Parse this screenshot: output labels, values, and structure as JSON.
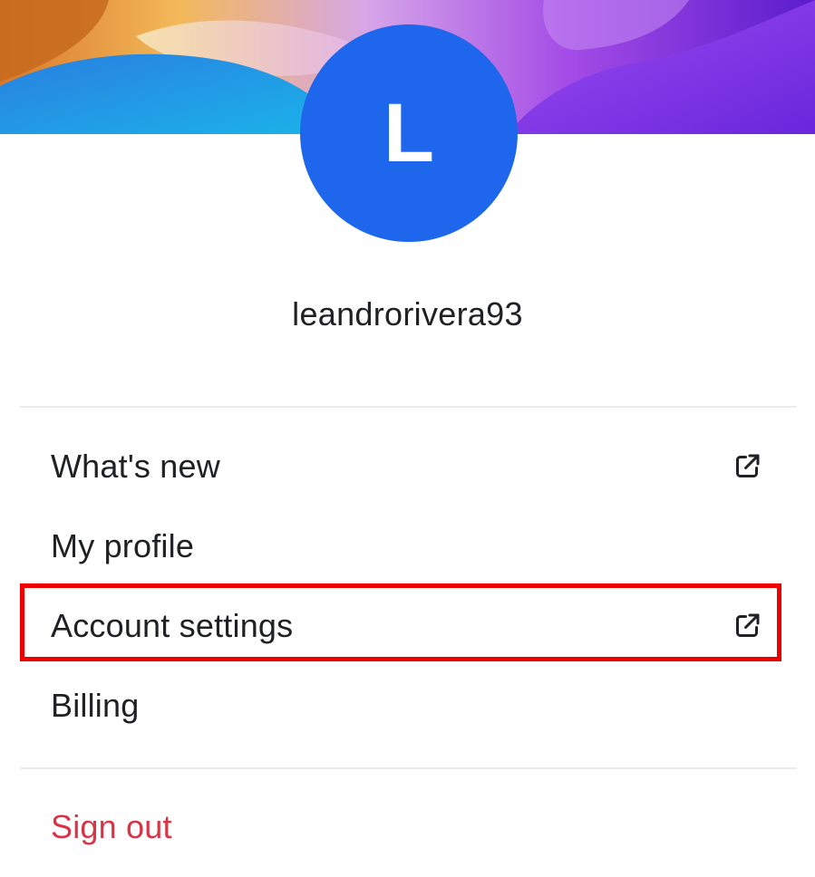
{
  "banner": {
    "colors": [
      "#e0892a",
      "#f7c45a",
      "#1ea6e6",
      "#b14fe6",
      "#7a2ee0",
      "#5f1fd0"
    ]
  },
  "avatar": {
    "initial": "L",
    "color": "#1e67ec"
  },
  "user": {
    "username": "leandrorivera93"
  },
  "menu": {
    "whats_new": {
      "label": "What's new",
      "icon": "external-link-icon"
    },
    "my_profile": {
      "label": "My profile"
    },
    "account_settings": {
      "label": "Account settings",
      "icon": "external-link-icon",
      "highlighted": true
    },
    "billing": {
      "label": "Billing"
    },
    "sign_out": {
      "label": "Sign out",
      "color": "#d93345"
    }
  },
  "highlight_color": "#ee0000"
}
